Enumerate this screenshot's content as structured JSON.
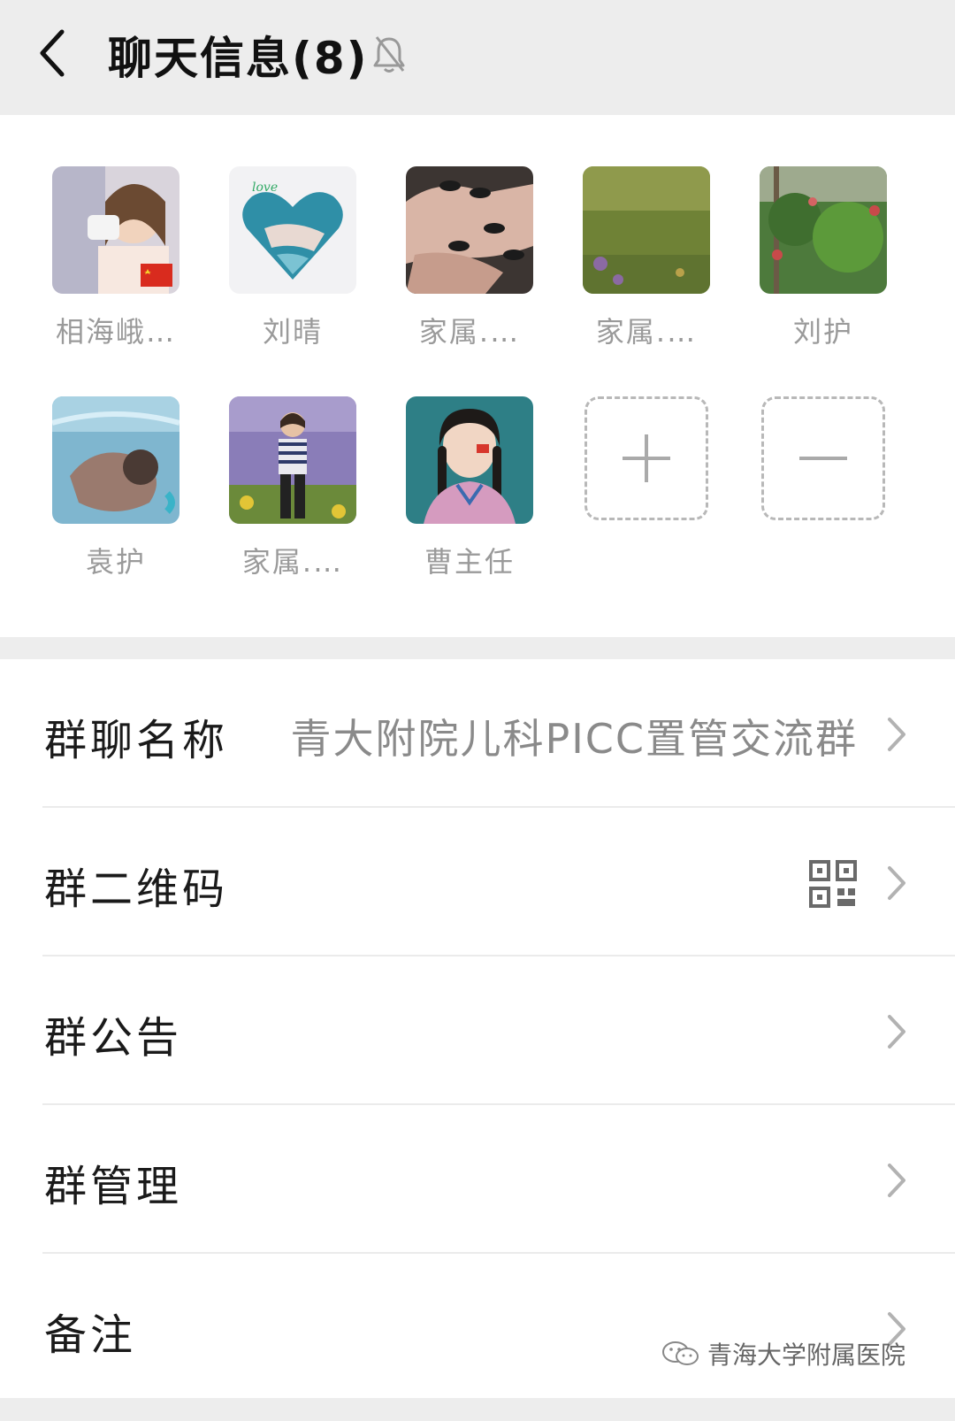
{
  "header": {
    "title": "聊天信息(8)",
    "back_icon": "chevron-left-icon",
    "mute_icon": "bell-off-icon"
  },
  "members": [
    {
      "name": "相海峨…",
      "avatar": "girl-drinking-avatar"
    },
    {
      "name": "刘晴",
      "avatar": "heart-photo-avatar"
    },
    {
      "name": "家属.…",
      "avatar": "nails-avatar"
    },
    {
      "name": "家属.…",
      "avatar": "grass-field-avatar"
    },
    {
      "name": "刘护",
      "avatar": "flower-bush-avatar"
    },
    {
      "name": "袁护",
      "avatar": "swimmer-avatar"
    },
    {
      "name": "家属.…",
      "avatar": "child-lavender-avatar"
    },
    {
      "name": "曹主任",
      "avatar": "braided-girl-avatar"
    }
  ],
  "actions": {
    "add_icon": "plus-icon",
    "remove_icon": "minus-icon"
  },
  "settings": [
    {
      "label": "群聊名称",
      "value": "青大附院儿科PICC置管交流群"
    },
    {
      "label": "群二维码",
      "value": "",
      "icon": "qr-code-icon"
    },
    {
      "label": "群公告",
      "value": ""
    },
    {
      "label": "群管理",
      "value": ""
    },
    {
      "label": "备注",
      "value": ""
    }
  ],
  "watermark": {
    "text": "青海大学附属医院",
    "icon": "wechat-icon"
  }
}
